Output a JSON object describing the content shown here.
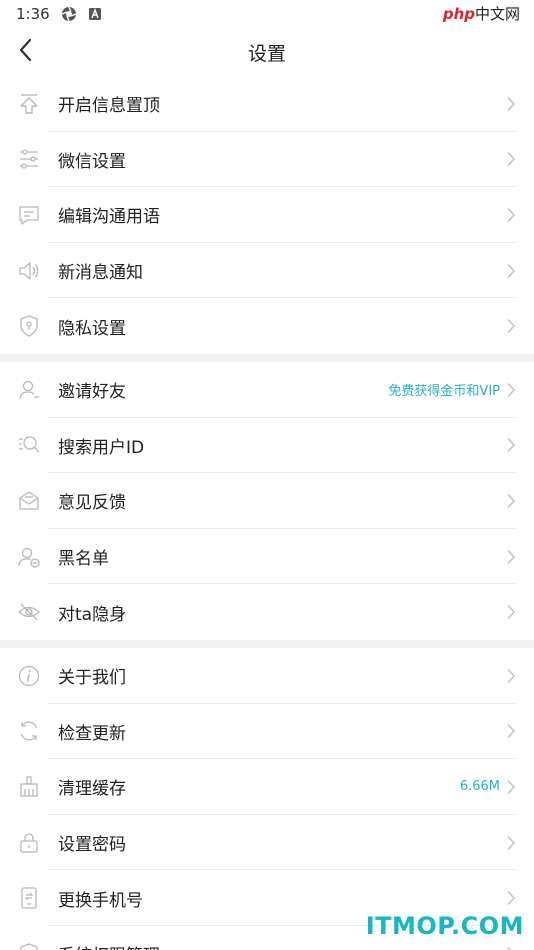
{
  "status_bar": {
    "time": "1:36",
    "icons": [
      "aperture-icon",
      "a-box-icon"
    ],
    "watermark_php": "php",
    "watermark_cn": "中文网"
  },
  "header": {
    "title": "设置",
    "back_icon": "chevron-left-icon"
  },
  "groups": [
    {
      "items": [
        {
          "label": "开启信息置顶",
          "icon": "pin-top-icon"
        },
        {
          "label": "微信设置",
          "icon": "sliders-icon"
        },
        {
          "label": "编辑沟通用语",
          "icon": "message-icon"
        },
        {
          "label": "新消息通知",
          "icon": "speaker-icon"
        },
        {
          "label": "隐私设置",
          "icon": "shield-icon"
        }
      ]
    },
    {
      "items": [
        {
          "label": "邀请好友",
          "icon": "user-icon",
          "extra": "免费获得金币和VIP"
        },
        {
          "label": "搜索用户ID",
          "icon": "search-icon"
        },
        {
          "label": "意见反馈",
          "icon": "feedback-icon"
        },
        {
          "label": "黑名单",
          "icon": "user-block-icon"
        },
        {
          "label": "对ta隐身",
          "icon": "eye-off-icon"
        }
      ]
    },
    {
      "items": [
        {
          "label": "关于我们",
          "icon": "info-icon"
        },
        {
          "label": "检查更新",
          "icon": "refresh-icon"
        },
        {
          "label": "清理缓存",
          "icon": "broom-icon",
          "extra": "6.66M"
        },
        {
          "label": "设置密码",
          "icon": "lock-icon"
        },
        {
          "label": "更换手机号",
          "icon": "phone-icon"
        },
        {
          "label": "系统权限管理",
          "icon": "permission-icon"
        }
      ]
    }
  ],
  "watermark": "ITMOP.COM",
  "colors": {
    "accent": "#21b3c4",
    "icon": "#b9b9b9",
    "chevron": "#c4c4c4",
    "divider": "#ececec",
    "group_gap": "#f1f1f1"
  }
}
